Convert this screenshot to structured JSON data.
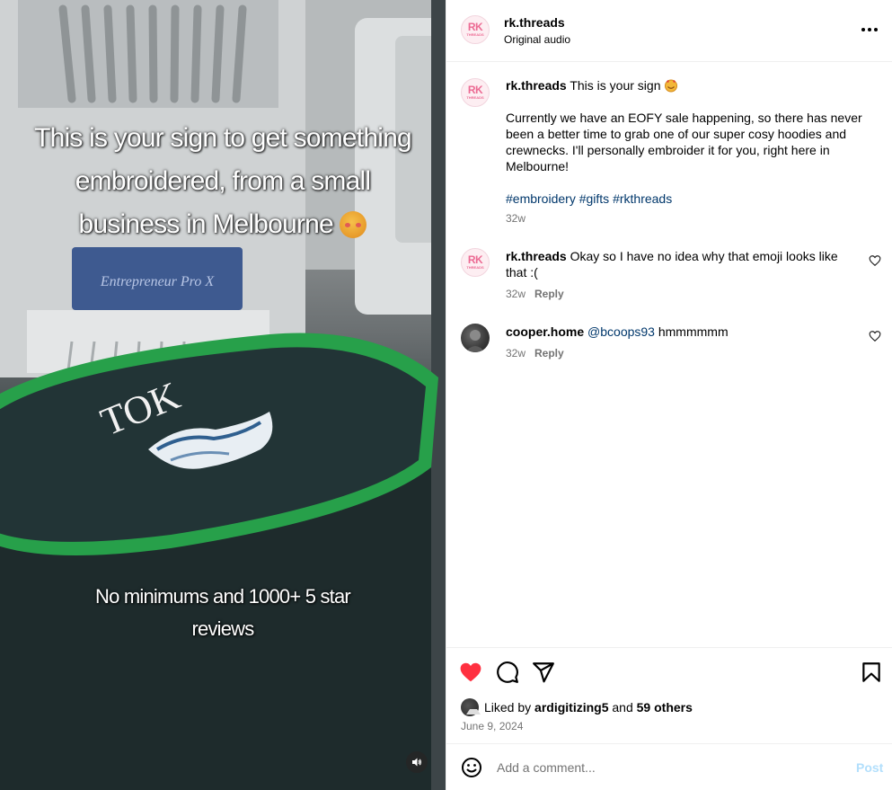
{
  "video": {
    "overlay_top": "This is your sign to get something embroidered, from a small business in Melbourne",
    "overlay_bottom": "No minimums and 1000+ 5 star reviews",
    "machine_brand": "Entrepreneur Pro X",
    "embroidery_text": "TOK",
    "mute_icon": "speaker-icon"
  },
  "header": {
    "username": "rk.threads",
    "audio": "Original audio",
    "avatar_text": "RK",
    "avatar_sub": "THREADS",
    "more_icon": "more-horizontal-icon"
  },
  "caption": {
    "username": "rk.threads",
    "first_line": "This is your sign",
    "paragraph": "Currently we have an EOFY sale happening, so there has never been a better time to grab one of our super cosy hoodies and crewnecks. I'll personally embroider it for you, right here in Melbourne!",
    "hashtags": [
      "#embroidery",
      "#gifts",
      "#rkthreads"
    ],
    "time": "32w"
  },
  "comments": [
    {
      "username": "rk.threads",
      "text": "Okay so I have no idea why that emoji looks like that :(",
      "time": "32w",
      "reply": "Reply"
    },
    {
      "username": "cooper.home",
      "mention": "@bcoops93",
      "text": "hmmmmmm",
      "time": "32w",
      "reply": "Reply"
    }
  ],
  "actions": {
    "liked_by_prefix": "Liked by",
    "liked_by_user": "ardigitizing5",
    "liked_by_and": "and",
    "liked_by_others": "59 others",
    "date": "June 9, 2024",
    "liked": true
  },
  "add_comment": {
    "placeholder": "Add a comment...",
    "post_label": "Post"
  },
  "colors": {
    "heart_red": "#ff3040",
    "link_blue": "#00376b",
    "post_disabled": "#b2dffc",
    "hoop_green": "#2f9a4a"
  }
}
